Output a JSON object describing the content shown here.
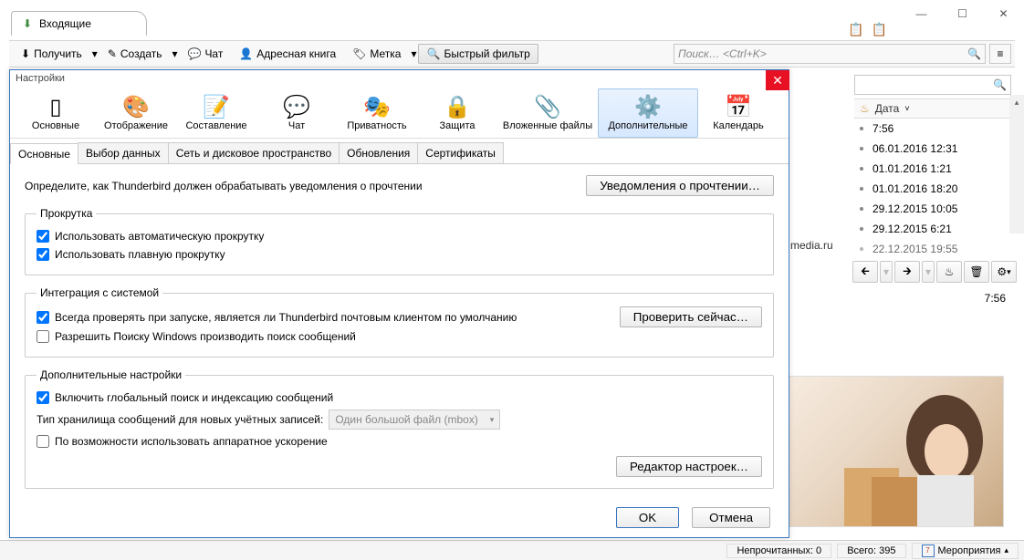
{
  "window": {
    "minimize": "—",
    "maximize": "☐",
    "close": "✕"
  },
  "tab": {
    "title": "Входящие"
  },
  "toolbar": {
    "receive": "Получить",
    "compose": "Создать",
    "chat": "Чат",
    "address": "Адресная книга",
    "tag": "Метка",
    "filter": "Быстрый фильтр",
    "search_ph": "Поиск… <Ctrl+K>"
  },
  "column": {
    "header": "Дата",
    "rows": [
      "7:56",
      "06.01.2016 12:31",
      "01.01.2016 1:21",
      "01.01.2016 18:20",
      "29.12.2015 10:05",
      "29.12.2015 6:21",
      "22.12.2015 19:55"
    ]
  },
  "partial_domain": "media.ru",
  "time_right": "7:56",
  "status": {
    "unread": "Непрочитанных: 0",
    "total": "Всего: 395",
    "events": "Мероприятия",
    "cal_num": "7"
  },
  "dialog": {
    "title": "Настройки",
    "cats": {
      "main": "Основные",
      "display": "Отображение",
      "compose": "Составление",
      "chat": "Чат",
      "privacy": "Приватность",
      "security": "Защита",
      "attach": "Вложенные файлы",
      "adv": "Дополнительные",
      "cal": "Календарь"
    },
    "subtabs": {
      "general": "Основные",
      "data": "Выбор данных",
      "net": "Сеть и дисковое пространство",
      "upd": "Обновления",
      "cert": "Сертификаты"
    },
    "read_desc": "Определите, как Thunderbird должен обрабатывать уведомления о прочтении",
    "read_btn": "Уведомления о прочтении…",
    "scroll": {
      "legend": "Прокрутка",
      "auto": "Использовать автоматическую прокрутку",
      "smooth": "Использовать плавную прокрутку"
    },
    "sys": {
      "legend": "Интеграция с системой",
      "default": "Всегда проверять при запуске, является ли Thunderbird почтовым клиентом по умолчанию",
      "check_now": "Проверить сейчас…",
      "winsearch": "Разрешить Поиску Windows производить поиск сообщений"
    },
    "extra": {
      "legend": "Дополнительные настройки",
      "global_search": "Включить глобальный поиск и индексацию сообщений",
      "store_lbl": "Тип хранилища сообщений для новых учётных записей:",
      "store_val": "Один большой файл (mbox)",
      "hw": "По возможности использовать аппаратное ускорение",
      "editor": "Редактор настроек…"
    },
    "ok": "OK",
    "cancel": "Отмена"
  }
}
